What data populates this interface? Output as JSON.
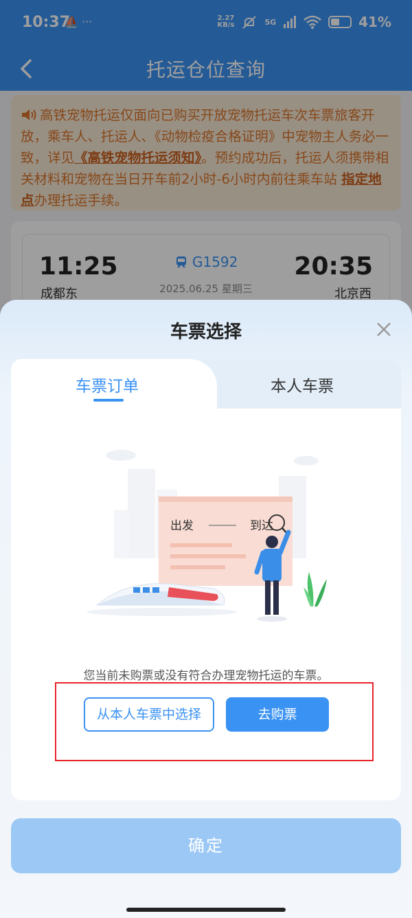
{
  "status_bar": {
    "time": "10:37",
    "left_icons": "⛵ ···",
    "net_speed_top": "2.27",
    "net_speed_bottom": "KB/s",
    "network": "5G",
    "battery": "41%"
  },
  "header": {
    "title": "托运仓位查询"
  },
  "notice": {
    "text_1": "高铁宠物托运仅面向已购买开放宠物托运车次车票旅客开放，乘车人、托运人、《动物检疫合格证明》中宠物主人务必一致，详见",
    "link_1": "《高铁宠物托运须知》",
    "text_2": "。预约成功后，托运人须携带相关材料和宠物在当日开车前2小时-6小时内前往乘车站 ",
    "link_2": "指定地点",
    "text_3": "办理托运手续。"
  },
  "train": {
    "depart_time": "11:25",
    "depart_station": "成都东",
    "train_no": "G1592",
    "date": "2025.06.25 星期三",
    "arrive_time": "20:35",
    "arrive_station": "北京西"
  },
  "sheet": {
    "title": "车票选择",
    "tabs": [
      {
        "label": "车票订单",
        "active": true
      },
      {
        "label": "本人车票",
        "active": false
      }
    ],
    "illustration": {
      "depart_label": "出发",
      "arrive_label": "到达"
    },
    "empty_message": "您当前未购票或没有符合办理宠物托运的车票。",
    "select_button": "从本人车票中选择",
    "buy_button": "去购票",
    "confirm_button": "确定"
  },
  "colors": {
    "primary": "#3a92f2",
    "notice_bg": "#f7e8d6",
    "notice_text": "#d9752a",
    "highlight": "#e8232a",
    "confirm_disabled": "#9cc8f6"
  }
}
